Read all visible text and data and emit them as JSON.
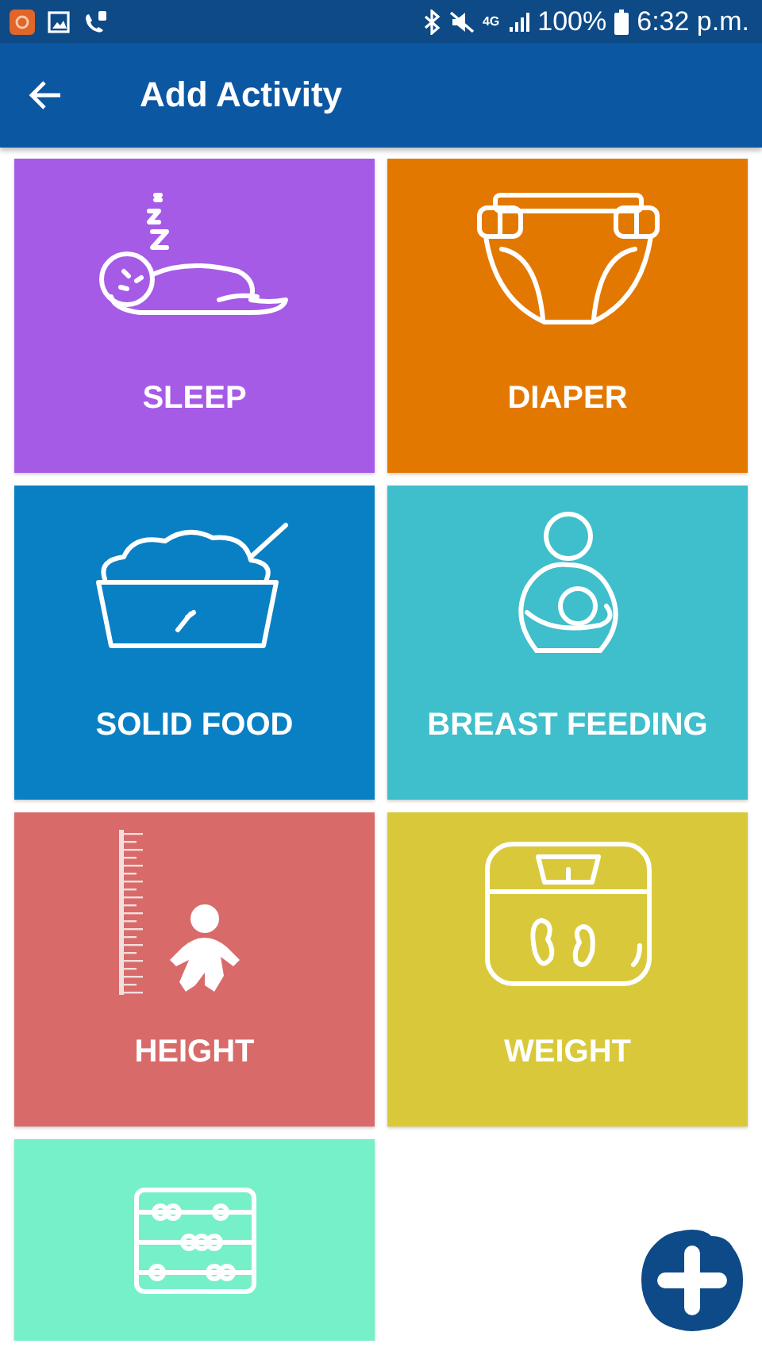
{
  "status_bar": {
    "network": "4G",
    "battery": "100%",
    "time": "6:32 p.m."
  },
  "app_bar": {
    "title": "Add Activity"
  },
  "activities": [
    {
      "kind": "sleep",
      "label": "SLEEP",
      "color": "#a65be6"
    },
    {
      "kind": "diaper",
      "label": "DIAPER",
      "color": "#e37800"
    },
    {
      "kind": "solid_food",
      "label": "SOLID FOOD",
      "color": "#0a80c4"
    },
    {
      "kind": "breast_feeding",
      "label": "BREAST FEEDING",
      "color": "#3fbecb"
    },
    {
      "kind": "height",
      "label": "HEIGHT",
      "color": "#d96a6a"
    },
    {
      "kind": "weight",
      "label": "WEIGHT",
      "color": "#d9c93a"
    },
    {
      "kind": "abacus",
      "color": "#76f0c8"
    }
  ]
}
